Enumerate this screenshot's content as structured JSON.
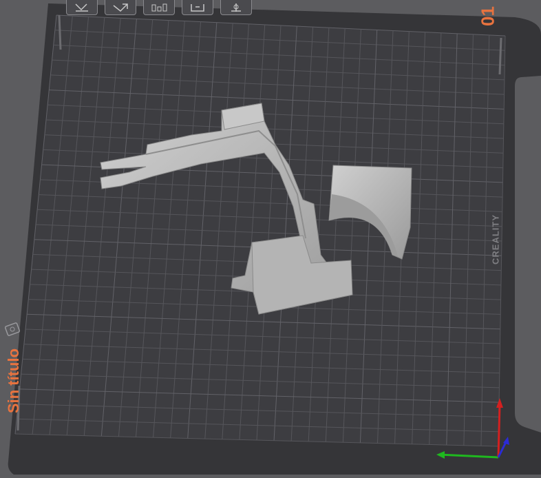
{
  "toolbar": {
    "buttons": [
      {
        "name": "pick-plate-icon"
      },
      {
        "name": "auto-orient-icon"
      },
      {
        "name": "arrange-icon"
      },
      {
        "name": "lock-plate-icon"
      },
      {
        "name": "plate-settings-icon"
      }
    ]
  },
  "plate": {
    "number": "01",
    "title": "Sin título",
    "brand": "CREALITY",
    "plate_icon": "plate-edit-icon"
  },
  "axes": {
    "x_color": "#1fb81f",
    "y_color": "#2b2bd6",
    "z_color": "#d42020"
  },
  "colors": {
    "background": "#5c5c5f",
    "bed": "#3a3a3d",
    "grid": "#55555a",
    "model": "#b8b8b8",
    "accent": "#e8733f"
  }
}
